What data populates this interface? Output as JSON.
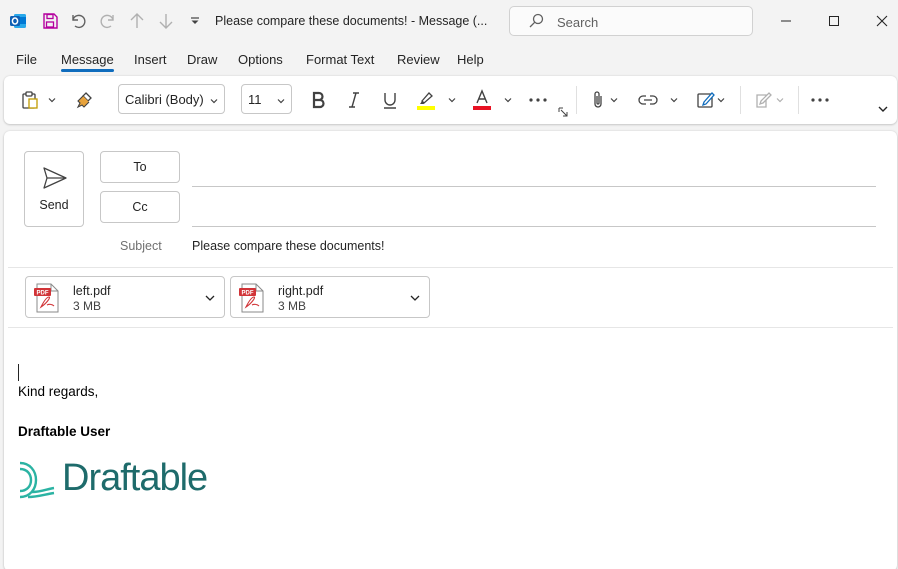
{
  "window": {
    "title": "Please compare these documents!  -  Message (...",
    "search_placeholder": "Search"
  },
  "menu": {
    "tabs": [
      "File",
      "Message",
      "Insert",
      "Draw",
      "Options",
      "Format Text",
      "Review",
      "Help"
    ],
    "active": "Message"
  },
  "ribbon": {
    "font_name": "Calibri (Body)",
    "font_size": "11",
    "highlight_color": "#ffff00",
    "font_color": "#e81123"
  },
  "compose": {
    "send_label": "Send",
    "to_label": "To",
    "cc_label": "Cc",
    "subject_label": "Subject",
    "subject_value": "Please compare these documents!",
    "attachments": [
      {
        "name": "left.pdf",
        "size": "3 MB"
      },
      {
        "name": "right.pdf",
        "size": "3 MB"
      }
    ],
    "body": {
      "closing": "Kind regards,",
      "signature_name": "Draftable User",
      "logo_text": "Draftable"
    }
  },
  "colors": {
    "accent": "#0f6cbd",
    "brand_teal": "#1e6b6b",
    "pdf_red": "#d13438"
  },
  "icons": {
    "app": "outlook-icon",
    "save": "save-icon",
    "undo": "undo-icon",
    "redo": "redo-icon",
    "search": "search-icon",
    "send": "send-icon",
    "attach": "paperclip-icon"
  }
}
